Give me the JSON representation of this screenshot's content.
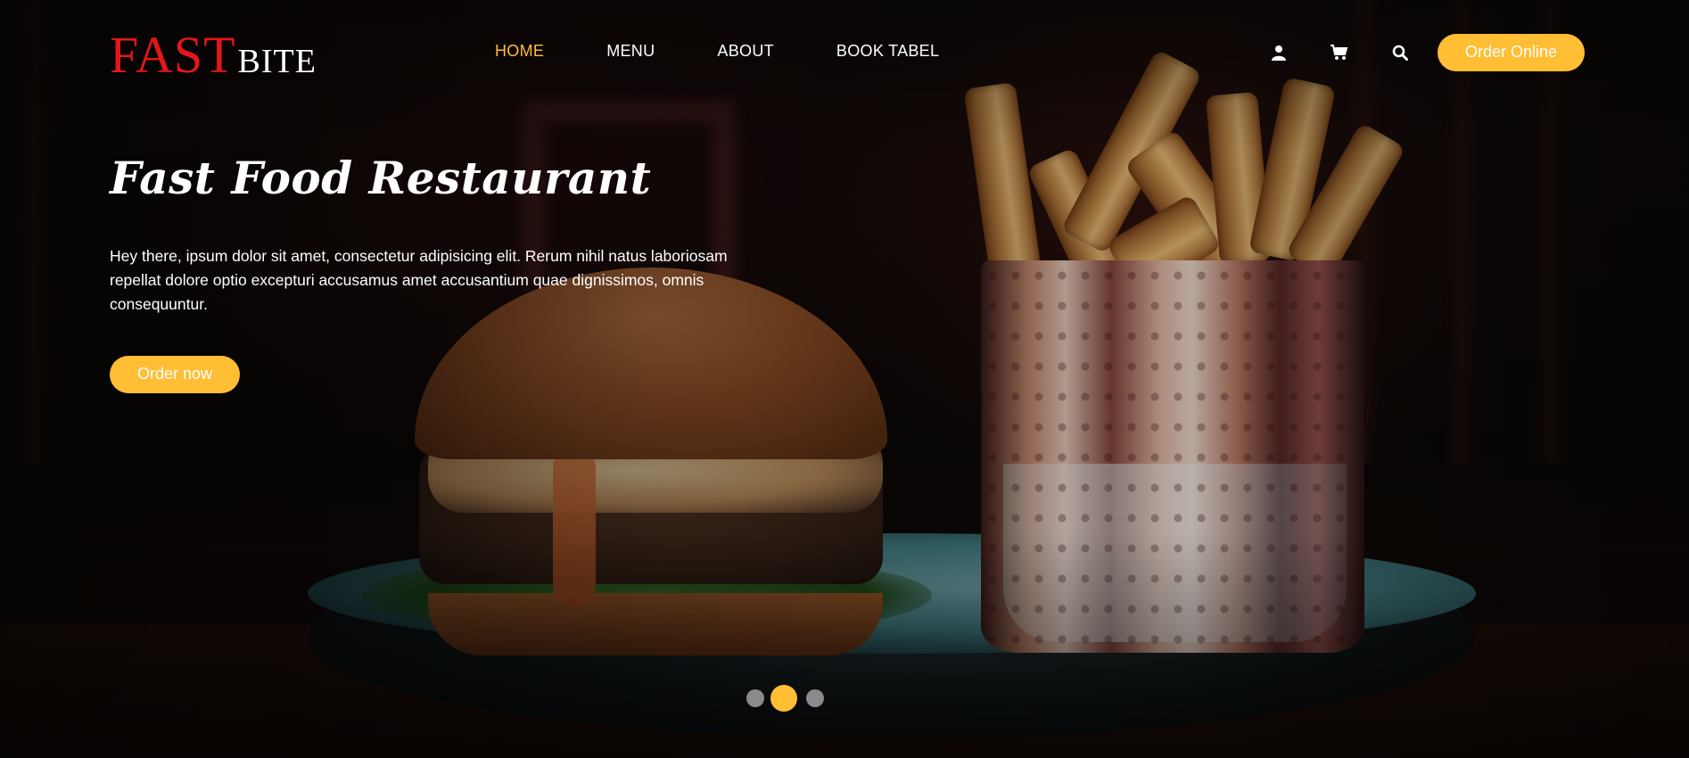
{
  "brand": {
    "part1": "FAST",
    "part2": "BITE",
    "primary_color": "#e3171b"
  },
  "nav": {
    "items": [
      {
        "label": "HOME",
        "active": true
      },
      {
        "label": "MENU",
        "active": false
      },
      {
        "label": "ABOUT",
        "active": false
      },
      {
        "label": "BOOK TABEL",
        "active": false
      }
    ]
  },
  "header_actions": {
    "icons": [
      "user-icon",
      "cart-icon",
      "search-icon"
    ],
    "order_online_label": "Order Online"
  },
  "hero": {
    "title": "Fast Food Restaurant",
    "text": "Hey there, ipsum dolor sit amet, consectetur adipisicing elit. Rerum nihil natus laboriosam repellat dolore optio excepturi accusamus amet accusantium quae dignissimos, omnis consequuntur.",
    "cta_label": "Order now"
  },
  "carousel": {
    "slides": 3,
    "active_index": 1
  },
  "colors": {
    "accent": "#ffbe33",
    "text": "#ffffff",
    "inactive_dot": "#8a8a8a"
  }
}
